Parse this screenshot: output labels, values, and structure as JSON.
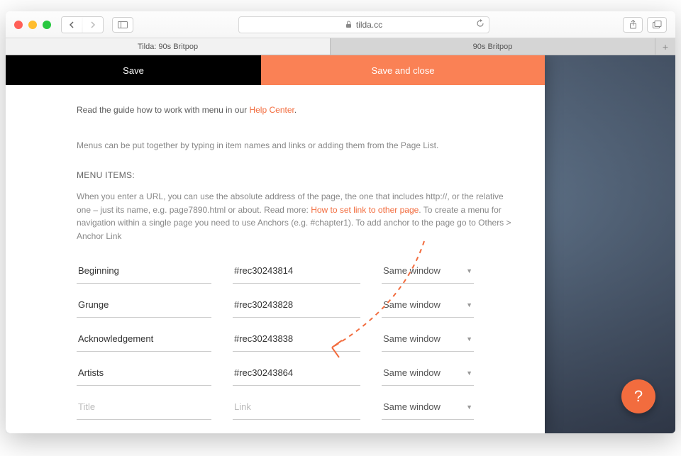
{
  "browser": {
    "url": "tilda.cc",
    "tabs": [
      {
        "label": "Tilda: 90s Britpop",
        "active": true
      },
      {
        "label": "90s Britpop",
        "active": false
      }
    ]
  },
  "panel": {
    "save_label": "Save",
    "save_close_label": "Save and close"
  },
  "content": {
    "guide_prefix": "Read the guide how to work with menu in our ",
    "guide_link": "Help Center",
    "guide_suffix": ".",
    "info1": "Menus can be put together by typing in item names and links or adding them from the Page List.",
    "section_head": "MENU ITEMS:",
    "info2_a": "When you enter a URL, you can use the absolute address of the page, the one that includes http://, or the relative one – just its name, e.g. page7890.html or about. Read more: ",
    "info2_link": "How to set link to other page",
    "info2_b": ". To create a menu for navigation within a single page you need to use Anchors (e.g. #chapter1). To add anchor to the page go to Others > Anchor Link"
  },
  "placeholders": {
    "title": "Title",
    "link": "Link"
  },
  "dropdown_label": "Same window",
  "menu_items": [
    {
      "title": "Beginning",
      "link": "#rec30243814"
    },
    {
      "title": "Grunge",
      "link": "#rec30243828"
    },
    {
      "title": "Acknowledgement",
      "link": "#rec30243838"
    },
    {
      "title": "Artists",
      "link": "#rec30243864"
    },
    {
      "title": "",
      "link": ""
    }
  ],
  "help_fab": "?"
}
